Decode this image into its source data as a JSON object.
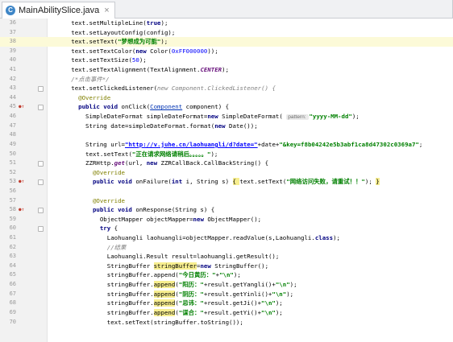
{
  "tab": {
    "label": "MainAbilitySlice.java",
    "close": "×"
  },
  "lines": [
    {
      "n": "36",
      "mark": "",
      "fold": false,
      "current": false,
      "indent": 5,
      "segs": [
        {
          "t": "text.setMultipleLine(",
          "c": ""
        },
        {
          "t": "true",
          "c": "kw"
        },
        {
          "t": ");",
          "c": ""
        }
      ]
    },
    {
      "n": "37",
      "mark": "",
      "fold": false,
      "current": false,
      "indent": 5,
      "segs": [
        {
          "t": "text.setLayoutConfig(config);",
          "c": ""
        }
      ]
    },
    {
      "n": "38",
      "mark": "",
      "fold": false,
      "current": true,
      "indent": 5,
      "segs": [
        {
          "t": "text.setText(",
          "c": ""
        },
        {
          "t": "\"梦想成为可能\"",
          "c": "str"
        },
        {
          "t": ");",
          "c": ""
        }
      ]
    },
    {
      "n": "39",
      "mark": "",
      "fold": false,
      "current": false,
      "indent": 5,
      "segs": [
        {
          "t": "text.setTextColor(",
          "c": ""
        },
        {
          "t": "new ",
          "c": "kw"
        },
        {
          "t": "Color(",
          "c": ""
        },
        {
          "t": "0xFF000000",
          "c": "num"
        },
        {
          "t": "));",
          "c": ""
        }
      ]
    },
    {
      "n": "40",
      "mark": "",
      "fold": false,
      "current": false,
      "indent": 5,
      "segs": [
        {
          "t": "text.setTextSize(",
          "c": ""
        },
        {
          "t": "50",
          "c": "num"
        },
        {
          "t": ");",
          "c": ""
        }
      ]
    },
    {
      "n": "41",
      "mark": "",
      "fold": false,
      "current": false,
      "indent": 5,
      "segs": [
        {
          "t": "text.setTextAlignment(TextAlignment.",
          "c": ""
        },
        {
          "t": "CENTER",
          "c": "fld"
        },
        {
          "t": ");",
          "c": ""
        }
      ]
    },
    {
      "n": "42",
      "mark": "",
      "fold": false,
      "current": false,
      "indent": 5,
      "segs": [
        {
          "t": "/*点击事件*/",
          "c": "cmt"
        }
      ]
    },
    {
      "n": "43",
      "mark": "",
      "fold": true,
      "current": false,
      "indent": 5,
      "segs": [
        {
          "t": "text.setClickedListener(",
          "c": ""
        },
        {
          "t": "new ",
          "c": "cmt"
        },
        {
          "t": "Component.ClickedListener() {",
          "c": "cmt"
        }
      ]
    },
    {
      "n": "44",
      "mark": "",
      "fold": false,
      "current": false,
      "indent": 7,
      "segs": [
        {
          "t": "@Override",
          "c": "ann"
        }
      ]
    },
    {
      "n": "45",
      "mark": "●↑",
      "fold": true,
      "current": false,
      "indent": 7,
      "segs": [
        {
          "t": "public void ",
          "c": "kw"
        },
        {
          "t": "onClick(",
          "c": ""
        },
        {
          "t": "Component",
          "c": "cls"
        },
        {
          "t": " component) {",
          "c": ""
        }
      ]
    },
    {
      "n": "46",
      "mark": "",
      "fold": false,
      "current": false,
      "indent": 9,
      "segs": [
        {
          "t": "SimpleDateFormat simpleDateFormat=",
          "c": ""
        },
        {
          "t": "new ",
          "c": "kw"
        },
        {
          "t": "SimpleDateFormat( ",
          "c": ""
        },
        {
          "t": "pattern: ",
          "c": "hint"
        },
        {
          "t": "\"yyyy-MM-dd\"",
          "c": "str"
        },
        {
          "t": ");",
          "c": ""
        }
      ]
    },
    {
      "n": "47",
      "mark": "",
      "fold": false,
      "current": false,
      "indent": 9,
      "segs": [
        {
          "t": "String date=simpleDateFormat.format(",
          "c": ""
        },
        {
          "t": "new ",
          "c": "kw"
        },
        {
          "t": "Date());",
          "c": ""
        }
      ]
    },
    {
      "n": "48",
      "mark": "",
      "fold": false,
      "current": false,
      "indent": 0,
      "segs": []
    },
    {
      "n": "49",
      "mark": "",
      "fold": false,
      "current": false,
      "indent": 9,
      "segs": [
        {
          "t": "String url=",
          "c": ""
        },
        {
          "t": "\"http://v.juhe.cn/laohuangli/d?date=\"",
          "c": "url"
        },
        {
          "t": "+date+",
          "c": ""
        },
        {
          "t": "\"&key=f8b04242e5b3abf1ca8d47302c0369a7\"",
          "c": "str"
        },
        {
          "t": ";",
          "c": ""
        }
      ]
    },
    {
      "n": "50",
      "mark": "",
      "fold": false,
      "current": false,
      "indent": 9,
      "segs": [
        {
          "t": "text.setText(",
          "c": ""
        },
        {
          "t": "\"正在请求网络请稍后。。。。。\"",
          "c": "str"
        },
        {
          "t": ");",
          "c": ""
        }
      ]
    },
    {
      "n": "51",
      "mark": "",
      "fold": true,
      "current": false,
      "indent": 9,
      "segs": [
        {
          "t": "ZZRHttp.",
          "c": ""
        },
        {
          "t": "get",
          "c": "fld"
        },
        {
          "t": "(url, ",
          "c": ""
        },
        {
          "t": "new ",
          "c": "kw"
        },
        {
          "t": "ZZRCallBack.CallBackString() {",
          "c": ""
        }
      ]
    },
    {
      "n": "52",
      "mark": "",
      "fold": false,
      "current": false,
      "indent": 11,
      "segs": [
        {
          "t": "@Override",
          "c": "ann"
        }
      ]
    },
    {
      "n": "53",
      "mark": "●↑",
      "fold": true,
      "current": false,
      "indent": 11,
      "segs": [
        {
          "t": "public void ",
          "c": "kw"
        },
        {
          "t": "onFailure(",
          "c": ""
        },
        {
          "t": "int ",
          "c": "kw"
        },
        {
          "t": "i, String s) ",
          "c": ""
        },
        {
          "t": "{ ",
          "c": "hl"
        },
        {
          "t": "text.setText(",
          "c": ""
        },
        {
          "t": "\"网络访问失败，请重试！！\"",
          "c": "str"
        },
        {
          "t": "); ",
          "c": ""
        },
        {
          "t": "}",
          "c": "hl"
        }
      ]
    },
    {
      "n": "56",
      "mark": "",
      "fold": false,
      "current": false,
      "indent": 0,
      "segs": []
    },
    {
      "n": "57",
      "mark": "",
      "fold": false,
      "current": false,
      "indent": 11,
      "segs": [
        {
          "t": "@Override",
          "c": "ann"
        }
      ]
    },
    {
      "n": "58",
      "mark": "●↑",
      "fold": true,
      "current": false,
      "indent": 11,
      "segs": [
        {
          "t": "public void ",
          "c": "kw"
        },
        {
          "t": "onResponse(String s) {",
          "c": ""
        }
      ]
    },
    {
      "n": "59",
      "mark": "",
      "fold": false,
      "current": false,
      "indent": 13,
      "segs": [
        {
          "t": "ObjectMapper objectMapper=",
          "c": ""
        },
        {
          "t": "new ",
          "c": "kw"
        },
        {
          "t": "ObjectMapper();",
          "c": ""
        }
      ]
    },
    {
      "n": "60",
      "mark": "",
      "fold": true,
      "current": false,
      "indent": 13,
      "segs": [
        {
          "t": "try ",
          "c": "kw"
        },
        {
          "t": "{",
          "c": ""
        }
      ]
    },
    {
      "n": "61",
      "mark": "",
      "fold": false,
      "current": false,
      "indent": 15,
      "segs": [
        {
          "t": "Laohuangli laohuangli=objectMapper.readValue(s,Laohuangli.",
          "c": ""
        },
        {
          "t": "class",
          "c": "kw"
        },
        {
          "t": ");",
          "c": ""
        }
      ]
    },
    {
      "n": "62",
      "mark": "",
      "fold": false,
      "current": false,
      "indent": 15,
      "segs": [
        {
          "t": "//结果",
          "c": "cmt"
        }
      ]
    },
    {
      "n": "63",
      "mark": "",
      "fold": false,
      "current": false,
      "indent": 15,
      "segs": [
        {
          "t": "Laohuangli.Result result=laohuangli.getResult();",
          "c": ""
        }
      ]
    },
    {
      "n": "64",
      "mark": "",
      "fold": false,
      "current": false,
      "indent": 15,
      "segs": [
        {
          "t": "StringBuffer ",
          "c": ""
        },
        {
          "t": "stringBuffer",
          "c": "hl"
        },
        {
          "t": "=",
          "c": ""
        },
        {
          "t": "new ",
          "c": "kw"
        },
        {
          "t": "StringBuffer();",
          "c": ""
        }
      ]
    },
    {
      "n": "65",
      "mark": "",
      "fold": false,
      "current": false,
      "indent": 15,
      "segs": [
        {
          "t": "stringBuffer.append(",
          "c": ""
        },
        {
          "t": "\"今日黄历：\"",
          "c": "str"
        },
        {
          "t": "+",
          "c": ""
        },
        {
          "t": "\"\\n\"",
          "c": "str"
        },
        {
          "t": ");",
          "c": ""
        }
      ]
    },
    {
      "n": "66",
      "mark": "",
      "fold": false,
      "current": false,
      "indent": 15,
      "segs": [
        {
          "t": "stringBuffer.",
          "c": ""
        },
        {
          "t": "append",
          "c": "hl"
        },
        {
          "t": "(",
          "c": ""
        },
        {
          "t": "\"阳历：\"",
          "c": "str"
        },
        {
          "t": "+result.getYangli()+",
          "c": ""
        },
        {
          "t": "\"\\n\"",
          "c": "str"
        },
        {
          "t": ");",
          "c": ""
        }
      ]
    },
    {
      "n": "67",
      "mark": "",
      "fold": false,
      "current": false,
      "indent": 15,
      "segs": [
        {
          "t": "stringBuffer.",
          "c": ""
        },
        {
          "t": "append",
          "c": "hl"
        },
        {
          "t": "(",
          "c": ""
        },
        {
          "t": "\"阴历：\"",
          "c": "str"
        },
        {
          "t": "+result.getYinli()+",
          "c": ""
        },
        {
          "t": "\"\\n\"",
          "c": "str"
        },
        {
          "t": ");",
          "c": ""
        }
      ]
    },
    {
      "n": "68",
      "mark": "",
      "fold": false,
      "current": false,
      "indent": 15,
      "segs": [
        {
          "t": "stringBuffer.",
          "c": ""
        },
        {
          "t": "append",
          "c": "hl"
        },
        {
          "t": "(",
          "c": ""
        },
        {
          "t": "\"忌讳：\"",
          "c": "str"
        },
        {
          "t": "+result.getJi()+",
          "c": ""
        },
        {
          "t": "\"\\n\"",
          "c": "str"
        },
        {
          "t": ");",
          "c": ""
        }
      ]
    },
    {
      "n": "69",
      "mark": "",
      "fold": false,
      "current": false,
      "indent": 15,
      "segs": [
        {
          "t": "stringBuffer.",
          "c": ""
        },
        {
          "t": "append",
          "c": "hl"
        },
        {
          "t": "(",
          "c": ""
        },
        {
          "t": "\"谋合：\"",
          "c": "str"
        },
        {
          "t": "+result.getYi()+",
          "c": ""
        },
        {
          "t": "\"\\n\"",
          "c": "str"
        },
        {
          "t": ");",
          "c": ""
        }
      ]
    },
    {
      "n": "70",
      "mark": "",
      "fold": false,
      "current": false,
      "indent": 15,
      "segs": [
        {
          "t": "text.setText(stringBuffer.toString());",
          "c": ""
        }
      ]
    }
  ]
}
